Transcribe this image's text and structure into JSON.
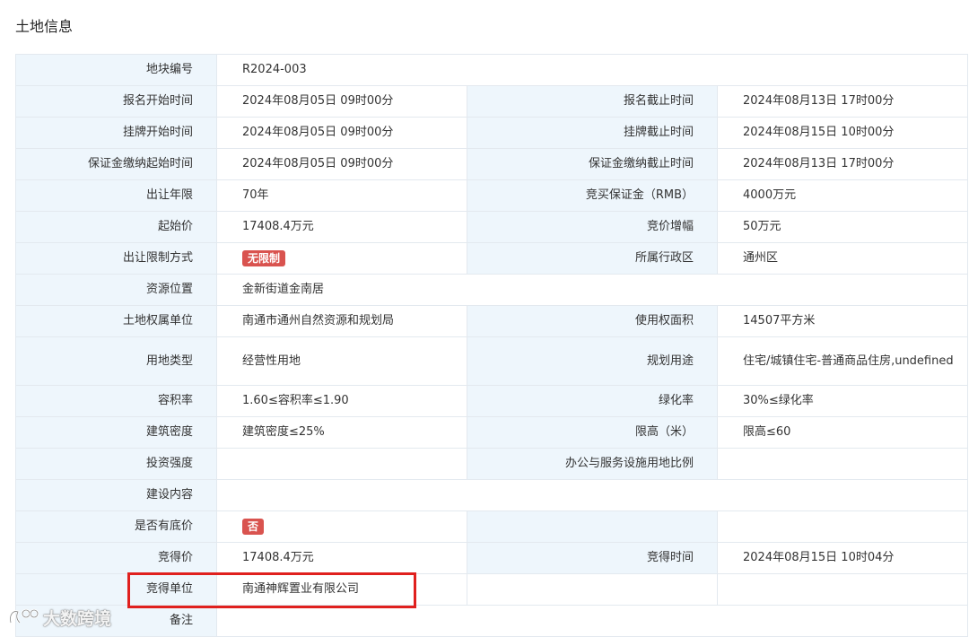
{
  "section_title": "土地信息",
  "parcel_no": {
    "label": "地块编号",
    "value": "R2024-003"
  },
  "rows": [
    {
      "l1": "报名开始时间",
      "v1": "2024年08月05日 09时00分",
      "l2": "报名截止时间",
      "v2": "2024年08月13日 17时00分"
    },
    {
      "l1": "挂牌开始时间",
      "v1": "2024年08月05日 09时00分",
      "l2": "挂牌截止时间",
      "v2": "2024年08月15日 10时00分"
    },
    {
      "l1": "保证金缴纳起始时间",
      "v1": "2024年08月05日 09时00分",
      "l2": "保证金缴纳截止时间",
      "v2": "2024年08月13日 17时00分"
    },
    {
      "l1": "出让年限",
      "v1": "70年",
      "l2": "竞买保证金（RMB）",
      "v2": "4000万元"
    },
    {
      "l1": "起始价",
      "v1": "17408.4万元",
      "l2": "竞价增幅",
      "v2": "50万元"
    },
    {
      "l1": "出让限制方式",
      "v1": "无限制",
      "l2": "所属行政区",
      "v2": "通州区"
    }
  ],
  "location": {
    "label": "资源位置",
    "value": "金新街道金南居"
  },
  "rows2": [
    {
      "l1": "土地权属单位",
      "v1": "南通市通州自然资源和规划局",
      "l2": "使用权面积",
      "v2": "14507平方米"
    },
    {
      "l1": "用地类型",
      "v1": "经营性用地",
      "l2": "规划用途",
      "v2": "住宅/城镇住宅-普通商品住房,undefined"
    },
    {
      "l1": "容积率",
      "v1": "1.60≤容积率≤1.90",
      "l2": "绿化率",
      "v2": "30%≤绿化率"
    },
    {
      "l1": "建筑密度",
      "v1": "建筑密度≤25%",
      "l2": "限高（米）",
      "v2": "限高≤60"
    },
    {
      "l1": "投资强度",
      "v1": "",
      "l2": "办公与服务设施用地比例",
      "v2": ""
    }
  ],
  "content": {
    "label": "建设内容",
    "value": ""
  },
  "reserve": {
    "label": "是否有底价",
    "value": "否",
    "v2": ""
  },
  "won": {
    "l1": "竞得价",
    "v1": "17408.4万元",
    "l2": "竞得时间",
    "v2": "2024年08月15日 10时04分"
  },
  "winner": {
    "label": "竞得单位",
    "value": "南通神辉置业有限公司"
  },
  "remarks": {
    "label": "备注",
    "value": ""
  },
  "watermark": {
    "text": "大数跨境"
  },
  "colors": {
    "label_bg": "#eef6fc",
    "border": "#e3e9ef",
    "badge": "#d9534f",
    "highlight": "#e0201e"
  }
}
